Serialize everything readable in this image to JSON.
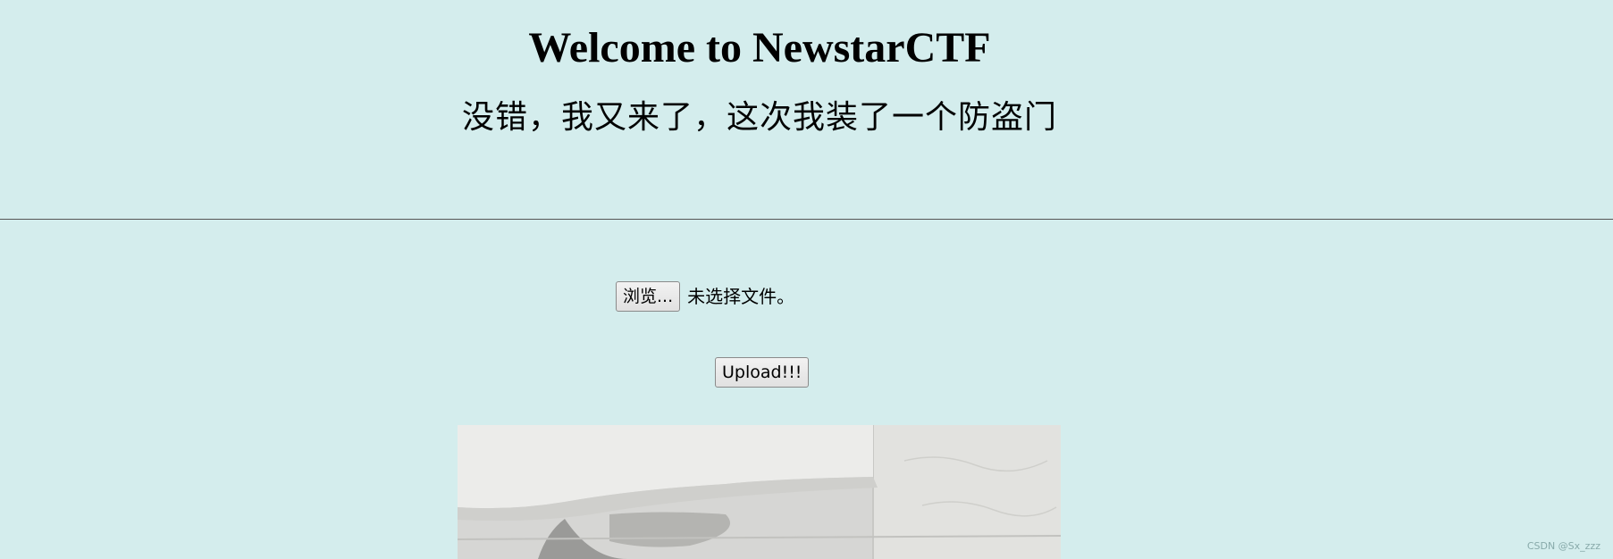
{
  "header": {
    "title": "Welcome to NewstarCTF",
    "subtitle": "没错，我又来了，这次我装了一个防盗门"
  },
  "upload_form": {
    "browse_label": "浏览...",
    "file_status": "未选择文件。",
    "submit_label": "Upload!!!"
  },
  "watermark": "CSDN @Sx_zzz"
}
